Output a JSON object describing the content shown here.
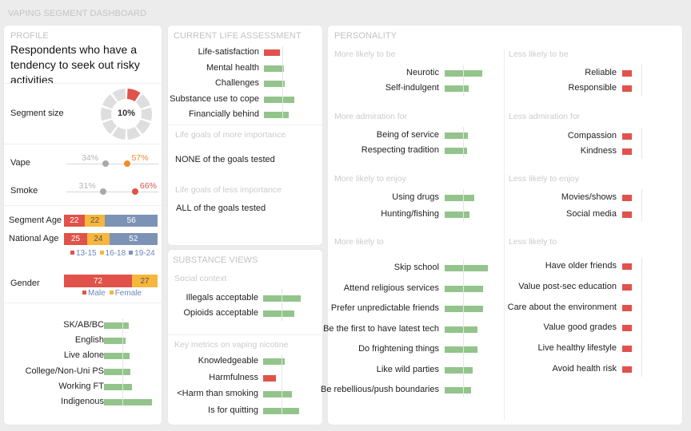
{
  "dashboard_title": "VAPING SEGMENT DASHBOARD",
  "colors": {
    "positive": "#93c48b",
    "negative": "#e0524a",
    "orange": "#f28a2e",
    "yellow": "#f7b63c",
    "slate": "#7d93b5",
    "gray_dot": "#a9a9a9",
    "legend_text": "#6b86bd"
  },
  "profile": {
    "title": "PROFILE",
    "description": "Respondents who have a tendency to seek out risky activities",
    "segment_size": {
      "label": "Segment size",
      "value": "10%",
      "fraction": 0.1
    },
    "usage": [
      {
        "label": "Vape",
        "national": "34%",
        "national_value": 34,
        "segment": "57%",
        "segment_value": 57,
        "segment_color": "#f28a2e"
      },
      {
        "label": "Smoke",
        "national": "31%",
        "national_value": 31,
        "segment": "66%",
        "segment_value": 66,
        "segment_color": "#e0524a"
      }
    ],
    "age": {
      "rows": [
        {
          "label": "Segment Age",
          "values": [
            22,
            22,
            56
          ]
        },
        {
          "label": "National Age",
          "values": [
            25,
            24,
            52
          ]
        }
      ],
      "legend": [
        "13-15",
        "16-18",
        "19-24"
      ]
    },
    "gender": {
      "label": "Gender",
      "values": [
        72,
        27
      ],
      "legend": [
        "Male",
        "Female"
      ]
    },
    "attributes": [
      {
        "label": "SK/AB/BC",
        "index": 1.35,
        "direction": "positive"
      },
      {
        "label": "English",
        "index": 1.17,
        "direction": "positive"
      },
      {
        "label": "Live alone",
        "index": 1.39,
        "direction": "positive"
      },
      {
        "label": "College/Non-Uni PS",
        "index": 1.43,
        "direction": "positive"
      },
      {
        "label": "Working FT",
        "index": 1.52,
        "direction": "positive"
      },
      {
        "label": "Indigenous",
        "index": 2.6,
        "direction": "positive"
      }
    ]
  },
  "life_assessment": {
    "title": "CURRENT LIFE ASSESSMENT",
    "items": [
      {
        "label": "Life-satisfaction",
        "index": 0.87,
        "direction": "negative"
      },
      {
        "label": "Mental health",
        "index": 1.09,
        "direction": "positive"
      },
      {
        "label": "Challenges",
        "index": 1.13,
        "direction": "positive"
      },
      {
        "label": "Substance use to cope",
        "index": 1.65,
        "direction": "positive"
      },
      {
        "label": "Financially behind",
        "index": 1.35,
        "direction": "positive"
      }
    ],
    "more_importance": {
      "heading": "Life goals of more importance",
      "text": "NONE of the goals tested"
    },
    "less_importance": {
      "heading": "Life goals of less importance",
      "text": "ALL of the goals tested"
    }
  },
  "substance_views": {
    "title": "SUBSTANCE VIEWS",
    "social_context": {
      "heading": "Social context",
      "items": [
        {
          "label": "Illegals acceptable",
          "index": 2.04,
          "direction": "positive"
        },
        {
          "label": "Opioids acceptable",
          "index": 1.7,
          "direction": "positive"
        }
      ]
    },
    "key_metrics": {
      "heading": "Key metrics on vaping nicotine",
      "items": [
        {
          "label": "Knowledgeable",
          "index": 1.17,
          "direction": "positive"
        },
        {
          "label": "Harmfulness",
          "index": 0.7,
          "direction": "negative"
        },
        {
          "label": "<Harm than smoking",
          "index": 1.57,
          "direction": "positive"
        },
        {
          "label": "Is for quitting",
          "index": 1.96,
          "direction": "positive"
        }
      ]
    }
  },
  "personality": {
    "title": "PERSONALITY",
    "more": [
      {
        "heading": "More likely to be",
        "items": [
          {
            "label": "Neurotic",
            "index": 2.04
          },
          {
            "label": "Self-indulgent",
            "index": 1.3
          }
        ]
      },
      {
        "heading": "More admiration for",
        "items": [
          {
            "label": "Being of service",
            "index": 1.26
          },
          {
            "label": "Respecting tradition",
            "index": 1.22
          }
        ]
      },
      {
        "heading": "More likely to enjoy",
        "items": [
          {
            "label": "Using drugs",
            "index": 1.61
          },
          {
            "label": "Hunting/fishing",
            "index": 1.35
          }
        ]
      },
      {
        "heading": "More likely to",
        "items": [
          {
            "label": "Skip school",
            "index": 2.35
          },
          {
            "label": "Attend religious services",
            "index": 2.09
          },
          {
            "label": "Prefer unpredictable friends",
            "index": 2.09
          },
          {
            "label": "Be the first to have latest tech",
            "index": 1.78
          },
          {
            "label": "Do frightening things",
            "index": 1.78
          },
          {
            "label": "Like wild parties",
            "index": 1.52
          },
          {
            "label": "Be rebellious/push boundaries",
            "index": 1.43
          }
        ]
      }
    ],
    "less": [
      {
        "heading": "Less likely to be",
        "items": [
          {
            "label": "Reliable",
            "index": 0.48
          },
          {
            "label": "Responsible",
            "index": 0.48
          }
        ]
      },
      {
        "heading": "Less admiration for",
        "items": [
          {
            "label": "Compassion",
            "index": 0.48
          },
          {
            "label": "Kindness",
            "index": 0.48
          }
        ]
      },
      {
        "heading": "Less likely to enjoy",
        "items": [
          {
            "label": "Movies/shows",
            "index": 0.48
          },
          {
            "label": "Social media",
            "index": 0.48
          }
        ]
      },
      {
        "heading": "Less likely to",
        "items": [
          {
            "label": "Have older friends",
            "index": 0.48
          },
          {
            "label": "Value post-sec education",
            "index": 0.48
          },
          {
            "label": "Care about the environment",
            "index": 0.48
          },
          {
            "label": "Value good grades",
            "index": 0.48
          },
          {
            "label": "Live healthy lifestyle",
            "index": 0.48
          },
          {
            "label": "Avoid health risk",
            "index": 0.48
          }
        ]
      }
    ]
  }
}
